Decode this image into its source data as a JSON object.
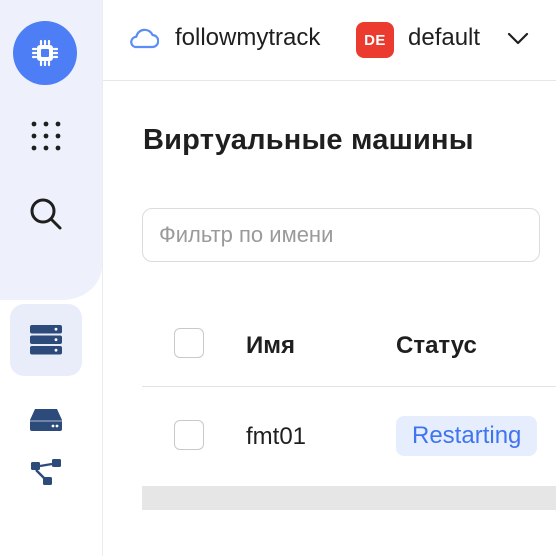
{
  "sidebar": {
    "items": [
      {
        "name": "compute-logo",
        "icon": "chip-icon",
        "active": false
      },
      {
        "name": "services",
        "icon": "grid-dots-icon"
      },
      {
        "name": "search",
        "icon": "search-icon"
      },
      {
        "name": "virtual-machines",
        "icon": "server-stack-icon",
        "active": true
      },
      {
        "name": "disks",
        "icon": "disk-icon"
      },
      {
        "name": "placement-groups",
        "icon": "tree-nodes-icon"
      }
    ],
    "accent_color": "#4e7ef5"
  },
  "header": {
    "cloud_name": "followmytrack",
    "folder_badge": "DE",
    "folder_badge_color": "#ea3b2e",
    "folder_name": "default"
  },
  "main": {
    "title": "Виртуальные машины",
    "filter": {
      "placeholder": "Фильтр по имени",
      "value": ""
    },
    "table": {
      "columns": [
        "Имя",
        "Статус"
      ],
      "rows": [
        {
          "name": "fmt01",
          "status": "Restarting",
          "status_color": "#3f74f1"
        }
      ]
    }
  }
}
